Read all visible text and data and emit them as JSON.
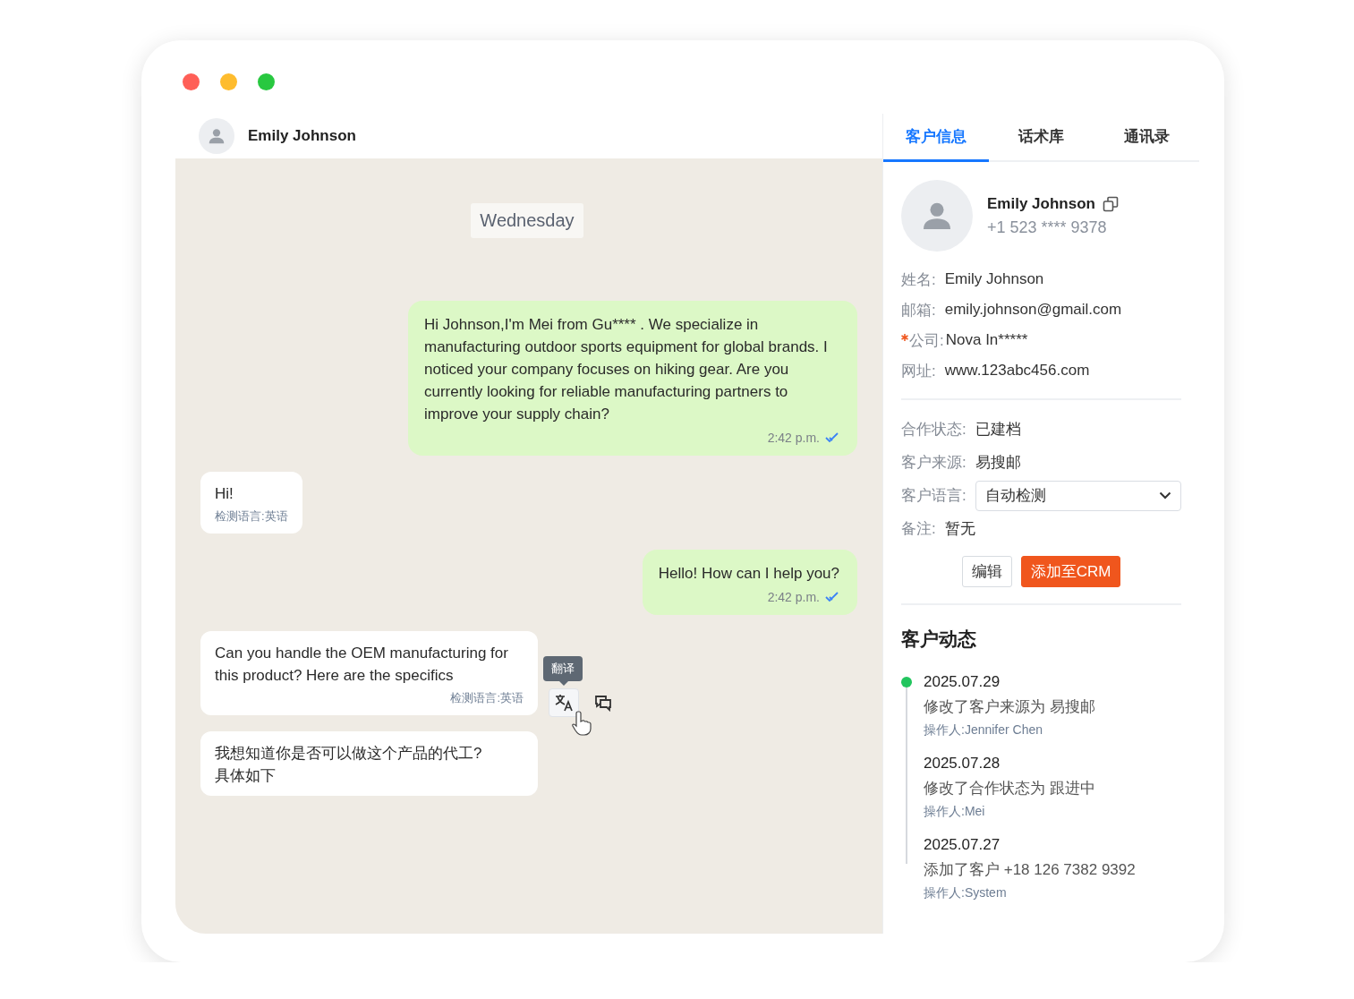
{
  "chat": {
    "contact_name": "Emily Johnson",
    "messages": [
      {
        "kind": "date",
        "text": "Wednesday"
      },
      {
        "kind": "outgoing",
        "text": "Hi Johnson,I'm Mei from Gu**** . We specialize in manufacturing outdoor sports equipment for global brands. I noticed your company focuses on hiking gear. Are you currently looking for reliable manufacturing partners to improve your supply chain?",
        "time": "2:42 p.m.",
        "read": true
      },
      {
        "kind": "incoming",
        "text": "Hi!",
        "detected_language": "检测语言:英语",
        "hovered": false
      },
      {
        "kind": "outgoing",
        "text": "Hello! How can I help you?",
        "time": "2:42 p.m.",
        "read": true
      },
      {
        "kind": "incoming",
        "text": "Can you handle the OEM manufacturing for this product? Here are the specifics",
        "detected_language": "检测语言:英语",
        "hovered": true,
        "tooltip": "翻译"
      },
      {
        "kind": "translation",
        "text": "我想知道你是否可以做这个产品的代工?\n具体如下"
      }
    ]
  },
  "panel": {
    "tabs": [
      {
        "label": "客户信息",
        "selected": true
      },
      {
        "label": "话术库",
        "selected": false
      },
      {
        "label": "通讯录",
        "selected": false
      }
    ],
    "profile": {
      "name": "Emily Johnson",
      "phone": "+1 523 **** 9378"
    },
    "contact_fields": [
      {
        "label": "姓名:",
        "value": "Emily Johnson",
        "required": false
      },
      {
        "label": "邮箱:",
        "value": "emily.johnson@gmail.com",
        "required": false
      },
      {
        "label": "公司:",
        "value": "Nova In*****",
        "required": true
      },
      {
        "label": "网址:",
        "value": "www.123abc456.com",
        "required": false
      }
    ],
    "status_fields": [
      {
        "kind": "text",
        "label": "合作状态:",
        "value": "已建档"
      },
      {
        "kind": "text",
        "label": "客户来源:",
        "value": "易搜邮"
      },
      {
        "kind": "select",
        "label": "客户语言:",
        "value": "自动检测"
      },
      {
        "kind": "text",
        "label": "备注:",
        "value": "暂无"
      }
    ],
    "buttons": [
      {
        "kind": "secondary",
        "label": "编辑"
      },
      {
        "kind": "primary",
        "label": "添加至CRM"
      }
    ],
    "activity": {
      "title": "客户动态",
      "entries": [
        {
          "date": "2025.07.29",
          "action": "修改了客户来源为 易搜邮",
          "operator": "操作人:Jennifer Chen",
          "active": true
        },
        {
          "date": "2025.07.28",
          "action": "修改了合作状态为 跟进中",
          "operator": "操作人:Mei",
          "active": false
        },
        {
          "date": "2025.07.27",
          "action": "添加了客户 +18 126 7382 9392",
          "operator": "操作人:System",
          "active": false
        }
      ]
    }
  }
}
